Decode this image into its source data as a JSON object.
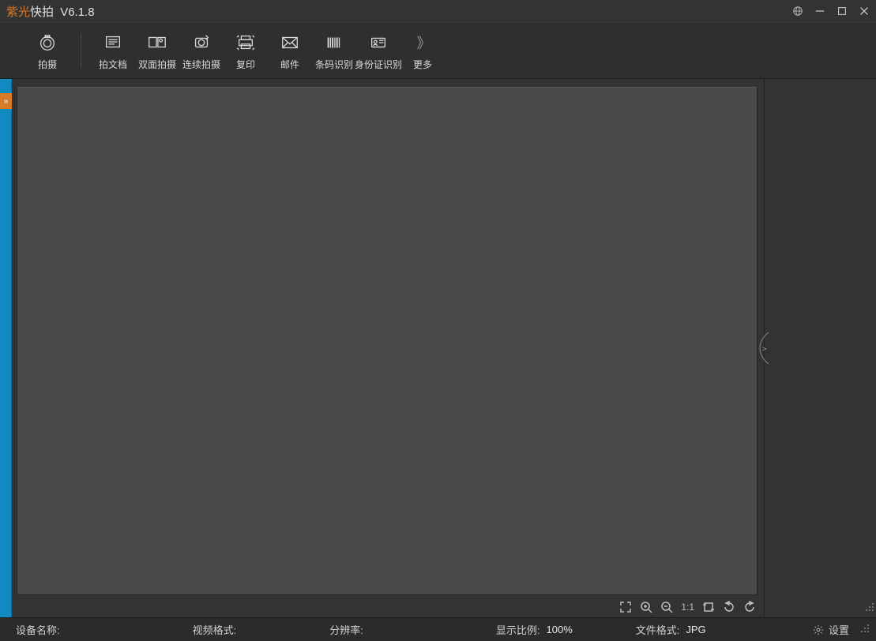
{
  "title": {
    "brand": "紫光",
    "app": "快拍",
    "version": "V6.1.8"
  },
  "toolbar": {
    "capture": "拍摄",
    "capture_doc": "拍文档",
    "double_side": "双面拍摄",
    "continuous": "连续拍摄",
    "copy": "复印",
    "mail": "邮件",
    "barcode": "条码识别",
    "idcard": "身份证识别",
    "more": "更多"
  },
  "status": {
    "device_label": "设备名称:",
    "device_value": "",
    "video_format_label": "视频格式:",
    "video_format_value": "",
    "resolution_label": "分辨率:",
    "resolution_value": "",
    "zoom_label": "显示比例:",
    "zoom_value": "100%",
    "file_format_label": "文件格式:",
    "file_format_value": "JPG",
    "settings": "设置"
  },
  "canvas_tools": {
    "fit": "fit",
    "zoom_in": "zoom-in",
    "zoom_out": "zoom-out",
    "actual_size": "1:1",
    "crop": "crop",
    "undo": "undo",
    "redo": "redo"
  }
}
